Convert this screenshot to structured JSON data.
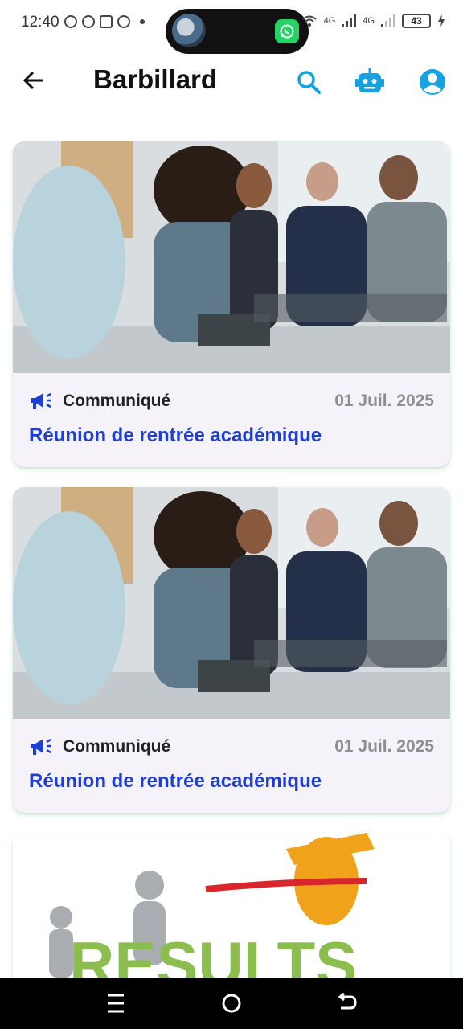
{
  "status_bar": {
    "time": "12:40",
    "network_1": "4G",
    "network_2": "4G",
    "battery": "43"
  },
  "app_bar": {
    "title": "Barbillard"
  },
  "colors": {
    "accent": "#14a3e0",
    "title_link": "#1f3ed2",
    "date_gray": "#8e8e8e",
    "card_bg": "#f5f2f9"
  },
  "posts": [
    {
      "category": "Communiqué",
      "date": "01 Juil. 2025",
      "title": "Réunion de rentrée académique",
      "image": "office-meeting-photo"
    },
    {
      "category": "Communiqué",
      "date": "01 Juil. 2025",
      "title": "Réunion de rentrée académique",
      "image": "office-meeting-photo"
    },
    {
      "image": "results-illustration",
      "image_text": "RESULTS"
    }
  ]
}
